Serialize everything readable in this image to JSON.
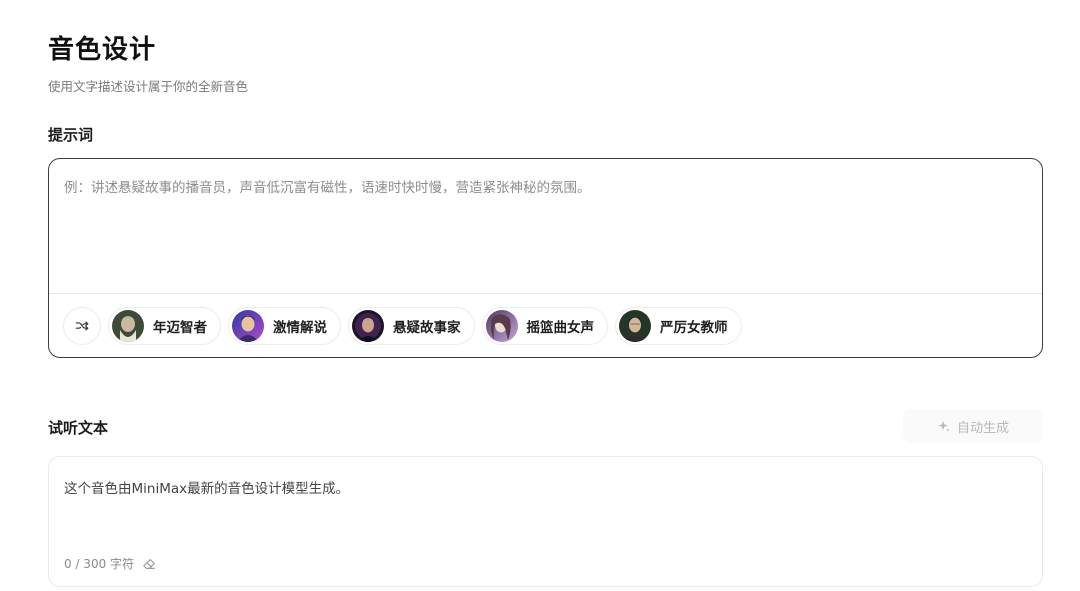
{
  "header": {
    "title": "音色设计",
    "subtitle": "使用文字描述设计属于你的全新音色"
  },
  "prompt": {
    "label": "提示词",
    "placeholder": "例：讲述悬疑故事的播音员，声音低沉富有磁性，语速时快时慢，营造紧张神秘的氛围。",
    "value": "",
    "shuffle_icon": "shuffle-icon",
    "presets": [
      {
        "label": "年迈智者",
        "avatar_colors": [
          "#3f4a3a",
          "#9aa38c",
          "#e9e4d4"
        ]
      },
      {
        "label": "激情解说",
        "avatar_colors": [
          "#2c3ea8",
          "#b347c9",
          "#e8c3a0"
        ]
      },
      {
        "label": "悬疑故事家",
        "avatar_colors": [
          "#1b1424",
          "#5a2a6e",
          "#c9a48f"
        ]
      },
      {
        "label": "摇篮曲女声",
        "avatar_colors": [
          "#4a3a66",
          "#c7a6d8",
          "#efdcd0"
        ]
      },
      {
        "label": "严厉女教师",
        "avatar_colors": [
          "#233628",
          "#5d7d60",
          "#d8b49b"
        ]
      }
    ]
  },
  "preview": {
    "label": "试听文本",
    "auto_generate_label": "自动生成",
    "auto_generate_icon": "sparkle-icon",
    "text": "这个音色由MiniMax最新的音色设计模型生成。",
    "char_count": "0 / 300 字符",
    "clear_icon": "eraser-icon"
  },
  "colors": {
    "prompt_border": "#3d3d3d",
    "preview_border": "#ebebeb",
    "muted_text": "#8d8d8d",
    "disabled_text": "#b9b9b9"
  }
}
